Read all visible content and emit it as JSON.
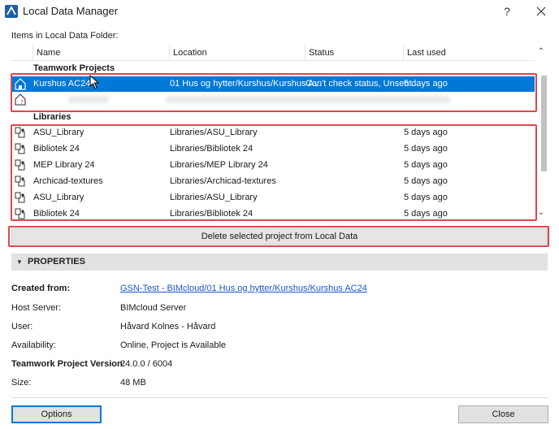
{
  "window": {
    "title": "Local Data Manager",
    "help_label": "?"
  },
  "list": {
    "caption": "Items in Local Data Folder:",
    "columns": [
      "Name",
      "Location",
      "Status",
      "Last used"
    ],
    "groups": [
      {
        "title": "Teamwork Projects",
        "rows": [
          {
            "icon": "teamwork-project-icon",
            "name": "Kurshus AC24",
            "location": "01 Hus og hytter/Kurshus/Kurshus A...",
            "status": "Can't check status, Unsent...",
            "last_used": "5 days ago",
            "selected": true
          },
          {
            "icon": "teamwork-project-unknown-icon",
            "name": "",
            "location": "",
            "status": "",
            "last_used": "",
            "selected": false
          }
        ]
      },
      {
        "title": "Libraries",
        "rows": [
          {
            "icon": "library-icon",
            "name": "ASU_Library",
            "location": "Libraries/ASU_Library",
            "status": "",
            "last_used": "5 days ago"
          },
          {
            "icon": "library-icon",
            "name": "Bibliotek 24",
            "location": "Libraries/Bibliotek 24",
            "status": "",
            "last_used": "5 days ago"
          },
          {
            "icon": "library-icon",
            "name": "MEP Library 24",
            "location": "Libraries/MEP Library 24",
            "status": "",
            "last_used": "5 days ago"
          },
          {
            "icon": "library-icon",
            "name": "Archicad-textures",
            "location": "Libraries/Archicad-textures",
            "status": "",
            "last_used": "5 days ago"
          },
          {
            "icon": "library-icon",
            "name": "ASU_Library",
            "location": "Libraries/ASU_Library",
            "status": "",
            "last_used": "5 days ago"
          },
          {
            "icon": "library-icon",
            "name": "Bibliotek 24",
            "location": "Libraries/Bibliotek 24",
            "status": "",
            "last_used": "5 days ago"
          }
        ]
      }
    ]
  },
  "delete_button": "Delete selected project from Local Data",
  "properties": {
    "header": "PROPERTIES",
    "items": [
      {
        "label": "Created from:",
        "value": "GSN-Test - BIMcloud/01 Hus og hytter/Kurshus/Kurshus AC24",
        "bold": true,
        "link": true
      },
      {
        "label": "Host Server:",
        "value": "BIMcloud Server",
        "bold": false,
        "link": false
      },
      {
        "label": "User:",
        "value": "Håvard Kolnes - Håvard",
        "bold": false,
        "link": false
      },
      {
        "label": "Availability:",
        "value": "Online, Project is Available",
        "bold": false,
        "link": false
      },
      {
        "label": "Teamwork Project Version:",
        "value": "24.0.0 / 6004",
        "bold": true,
        "link": false
      },
      {
        "label": "Size:",
        "value": "48 MB",
        "bold": false,
        "link": false
      }
    ]
  },
  "footer": {
    "options_label": "Options",
    "close_label": "Close"
  },
  "colors": {
    "selection": "#0078d7",
    "highlight_box": "#e0464c",
    "link": "#1a56d6"
  }
}
